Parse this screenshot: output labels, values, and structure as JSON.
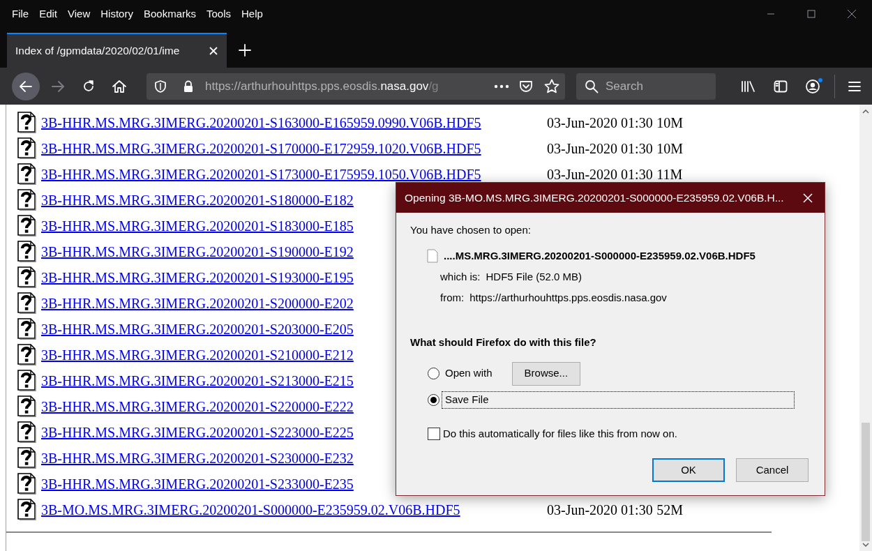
{
  "menu_bar": [
    {
      "label": "File"
    },
    {
      "label": "Edit"
    },
    {
      "label": "View"
    },
    {
      "label": "History"
    },
    {
      "label": "Bookmarks"
    },
    {
      "label": "Tools"
    },
    {
      "label": "Help"
    }
  ],
  "tabs": [
    {
      "title": "Index of /gpmdata/2020/02/01/ime",
      "selected": true
    }
  ],
  "toolbar": {
    "forward_disabled": true,
    "sync_notification": true
  },
  "url_bar": {
    "prefix": "https://arthurhouhttps.pps.eosdis.",
    "domain": "nasa.gov",
    "suffix": "/g"
  },
  "search": {
    "placeholder": "Search"
  },
  "listing": [
    {
      "name": "3B-HHR.MS.MRG.3IMERG.20200201-S163000-E165959.0990.V06B.HDF5",
      "modified": "03-Jun-2020 01:30",
      "size": "10M"
    },
    {
      "name": "3B-HHR.MS.MRG.3IMERG.20200201-S170000-E172959.1020.V06B.HDF5",
      "modified": "03-Jun-2020 01:30",
      "size": "10M"
    },
    {
      "name": "3B-HHR.MS.MRG.3IMERG.20200201-S173000-E175959.1050.V06B.HDF5",
      "modified": "03-Jun-2020 01:30",
      "size": "11M"
    },
    {
      "name": "3B-HHR.MS.MRG.3IMERG.20200201-S180000-E182"
    },
    {
      "name": "3B-HHR.MS.MRG.3IMERG.20200201-S183000-E185"
    },
    {
      "name": "3B-HHR.MS.MRG.3IMERG.20200201-S190000-E192"
    },
    {
      "name": "3B-HHR.MS.MRG.3IMERG.20200201-S193000-E195"
    },
    {
      "name": "3B-HHR.MS.MRG.3IMERG.20200201-S200000-E202"
    },
    {
      "name": "3B-HHR.MS.MRG.3IMERG.20200201-S203000-E205"
    },
    {
      "name": "3B-HHR.MS.MRG.3IMERG.20200201-S210000-E212"
    },
    {
      "name": "3B-HHR.MS.MRG.3IMERG.20200201-S213000-E215"
    },
    {
      "name": "3B-HHR.MS.MRG.3IMERG.20200201-S220000-E222"
    },
    {
      "name": "3B-HHR.MS.MRG.3IMERG.20200201-S223000-E225"
    },
    {
      "name": "3B-HHR.MS.MRG.3IMERG.20200201-S230000-E232"
    },
    {
      "name": "3B-HHR.MS.MRG.3IMERG.20200201-S233000-E235"
    },
    {
      "name": "3B-MO.MS.MRG.3IMERG.20200201-S000000-E235959.02.V06B.HDF5",
      "modified": "03-Jun-2020 01:30",
      "size": "52M"
    }
  ],
  "dialog": {
    "title": "Opening 3B-MO.MS.MRG.3IMERG.20200201-S000000-E235959.02.V06B.H...",
    "intro": "You have chosen to open:",
    "file_name": "....MS.MRG.3IMERG.20200201-S000000-E235959.02.V06B.HDF5",
    "type_label": "which is:",
    "type_value": "HDF5 File (52.0 MB)",
    "from_label": "from:",
    "from_value": "https://arthurhouhttps.pps.eosdis.nasa.gov",
    "question": "What should Firefox do with this file?",
    "options": [
      {
        "label": "Open with",
        "selected": false,
        "focused": false,
        "button": {
          "label": "Browse..."
        }
      },
      {
        "label": "Save File",
        "selected": true,
        "focused": true
      }
    ],
    "remember": {
      "label": "Do this automatically for files like this from now on.",
      "checked": false
    },
    "buttons": [
      {
        "label": "OK",
        "default": true
      },
      {
        "label": "Cancel",
        "default": false
      }
    ]
  }
}
